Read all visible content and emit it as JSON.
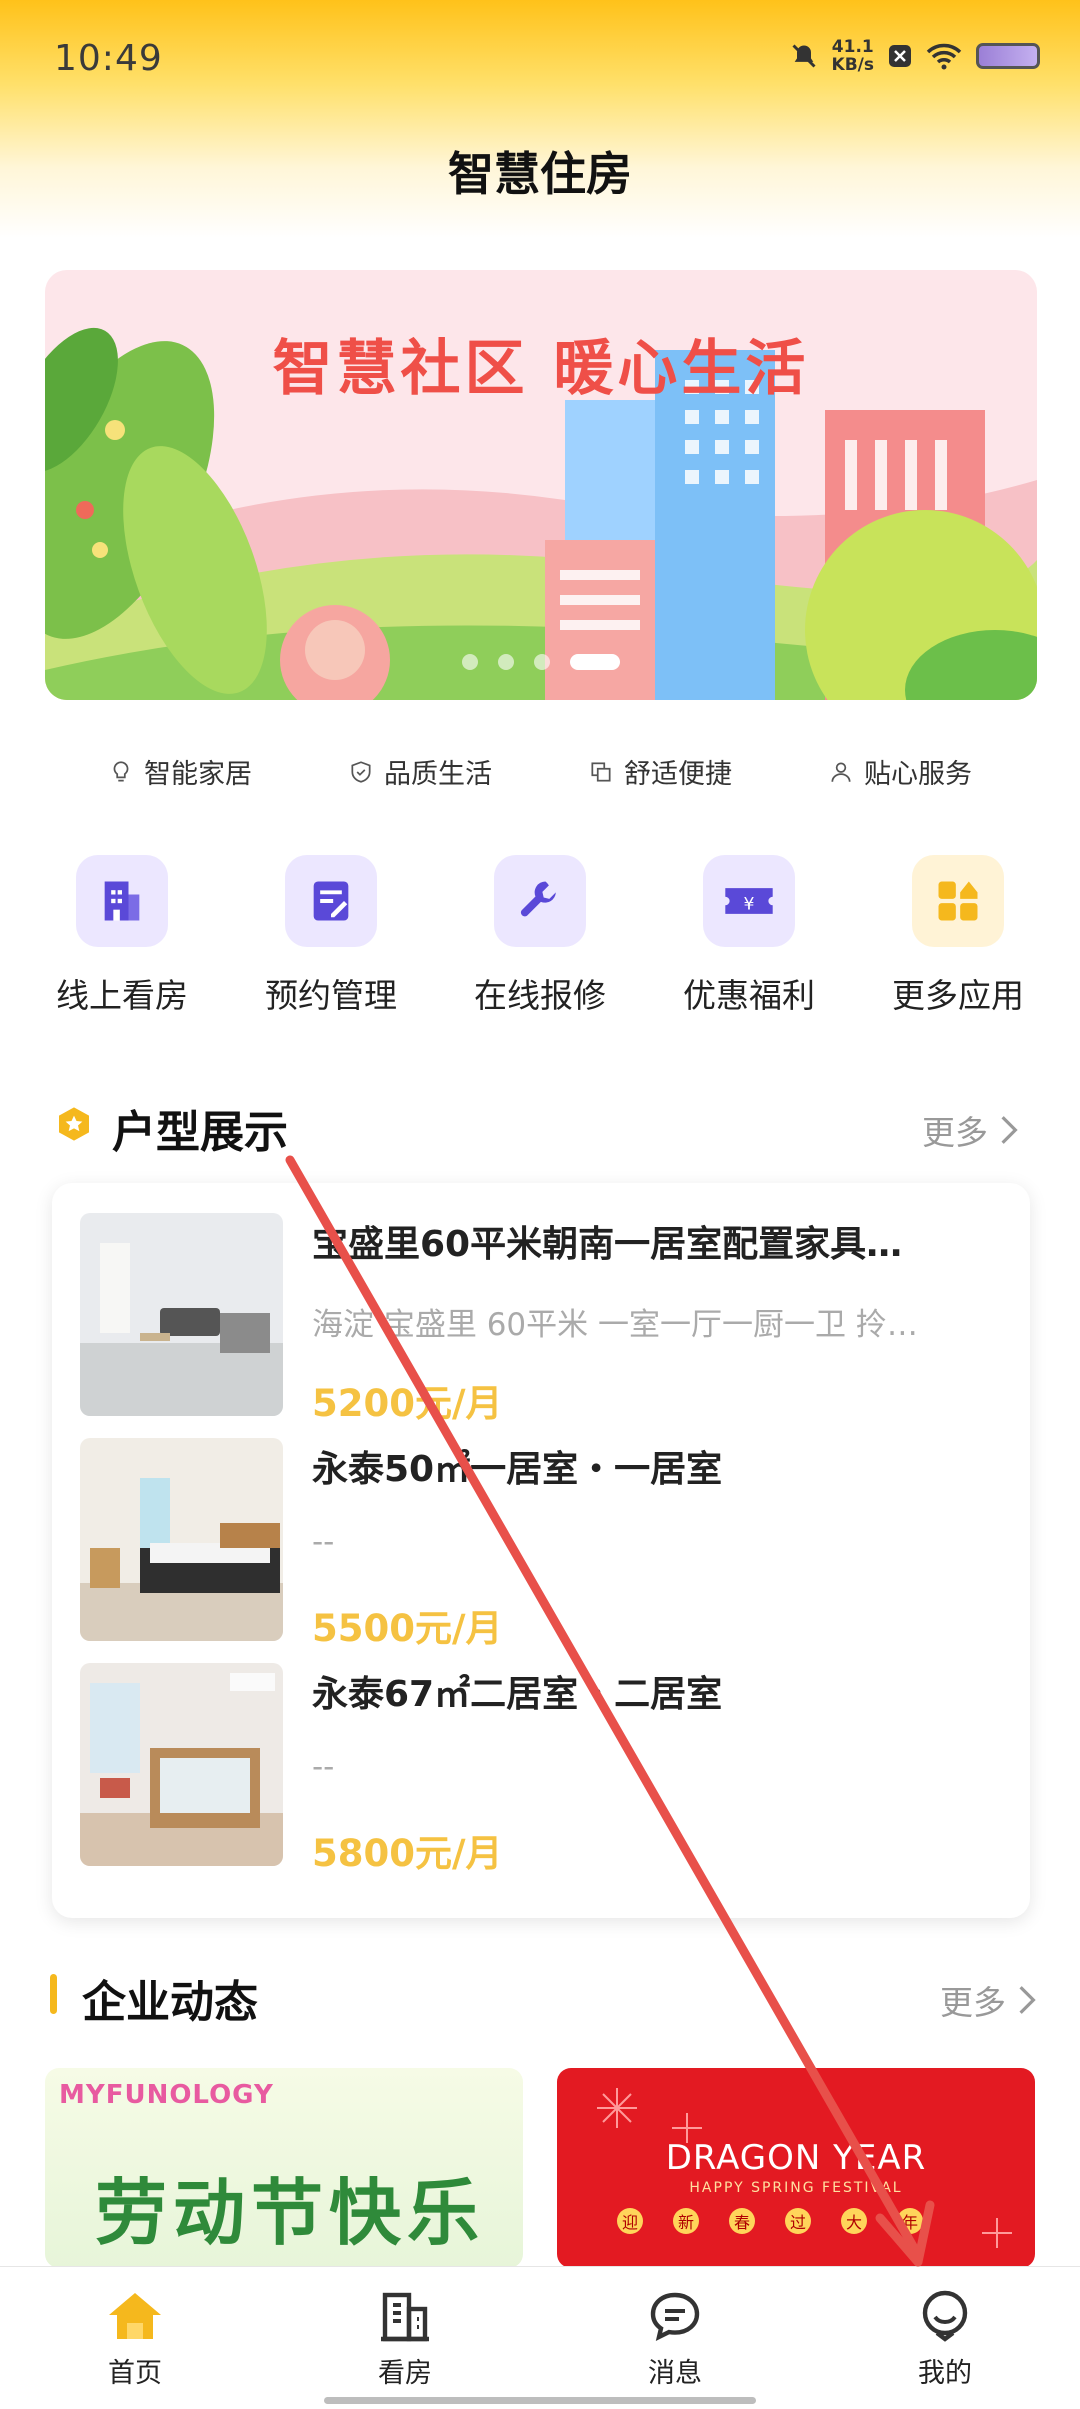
{
  "status": {
    "time": "10:49",
    "net_speed_value": "41.1",
    "net_speed_unit": "KB/s"
  },
  "header": {
    "title": "智慧住房"
  },
  "banner": {
    "headline": "智慧社区  暖心生活",
    "slide_count": 4,
    "active_slide": 4
  },
  "features": [
    {
      "label": "智能家居",
      "icon": "lightbulb-icon"
    },
    {
      "label": "品质生活",
      "icon": "shield-icon"
    },
    {
      "label": "舒适便捷",
      "icon": "copy-icon"
    },
    {
      "label": "贴心服务",
      "icon": "person-icon"
    }
  ],
  "apps": [
    {
      "label": "线上看房",
      "icon": "building-icon"
    },
    {
      "label": "预约管理",
      "icon": "edit-icon"
    },
    {
      "label": "在线报修",
      "icon": "wrench-icon"
    },
    {
      "label": "优惠福利",
      "icon": "ticket-icon"
    },
    {
      "label": "更多应用",
      "icon": "grid-icon"
    }
  ],
  "house_section": {
    "title": "户型展示",
    "more_label": "更多"
  },
  "houses": [
    {
      "name": "宝盛里60平米朝南一居室配置家具…",
      "desc": "海淀 宝盛里 60平米 一室一厅一厨一卫 拎…",
      "price": "5200元/月"
    },
    {
      "name": "永泰50㎡一居室・一居室",
      "desc": "--",
      "price": "5500元/月"
    },
    {
      "name": "永泰67㎡二居室・二居室",
      "desc": "--",
      "price": "5800元/月"
    }
  ],
  "news_section": {
    "title": "企业动态",
    "more_label": "更多"
  },
  "news": [
    {
      "brand": "MYFUNOLOGY",
      "headline": "劳动节快乐"
    },
    {
      "headline": "DRAGON YEAR",
      "sub": "HAPPY SPRING FESTIVAL",
      "chars": [
        "迎",
        "新",
        "春",
        "过",
        "大",
        "年"
      ]
    }
  ],
  "tabs": [
    {
      "label": "首页",
      "icon": "home-icon",
      "active": true
    },
    {
      "label": "看房",
      "icon": "building-outline-icon",
      "active": false
    },
    {
      "label": "消息",
      "icon": "message-icon",
      "active": false
    },
    {
      "label": "我的",
      "icon": "profile-icon",
      "active": false
    }
  ],
  "colors": {
    "accent": "#f5c242",
    "brand_yellow": "#ffc21a",
    "app_icon_purple": "#5a49d8",
    "annotation_arrow": "#e8504a"
  }
}
